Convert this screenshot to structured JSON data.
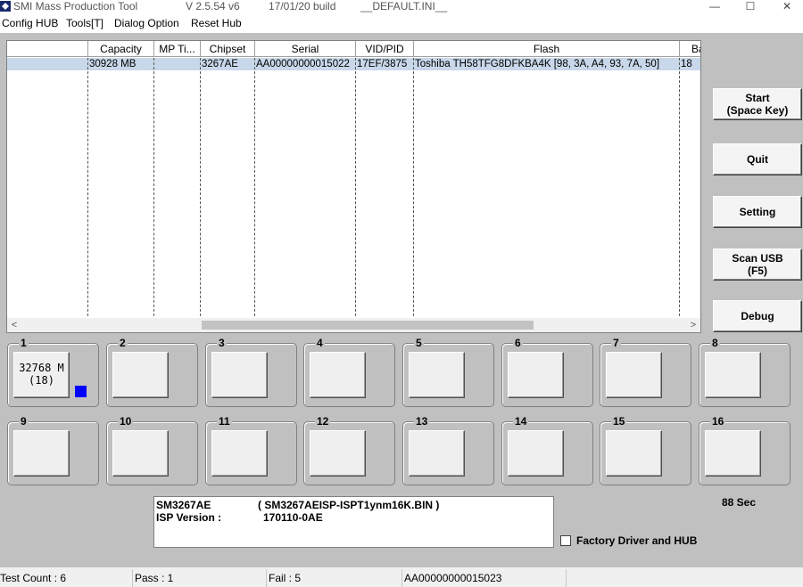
{
  "window": {
    "title": "SMI Mass Production Tool",
    "version": "V 2.5.54   v6",
    "build": "17/01/20 build",
    "ini": "__DEFAULT.INI__",
    "minimize": "—",
    "maximize": "☐",
    "close": "✕"
  },
  "menu": [
    "Config HUB",
    "Tools[T]",
    "Dialog Option",
    "Reset Hub"
  ],
  "list": {
    "columns": [
      "",
      "Capacity",
      "MP Ti...",
      "Chipset",
      "Serial",
      "VID/PID",
      "Flash",
      "Ba"
    ],
    "rows": [
      {
        "cells": [
          "",
          "30928 MB",
          "",
          "3267AE",
          "AA00000000015022",
          "17EF/3875",
          "Toshiba TH58TFG8DFKBA4K [98, 3A, A4, 93, 7A, 50]",
          "18"
        ]
      }
    ],
    "scroll_left": "<",
    "scroll_right": ">"
  },
  "actions": {
    "start": "Start\n(Space Key)",
    "quit": "Quit",
    "setting": "Setting",
    "scan_usb": "Scan USB\n(F5)",
    "debug": "Debug"
  },
  "ports": [
    {
      "num": "1",
      "label": "32768 M\n(18)",
      "status": true
    },
    {
      "num": "2",
      "label": "",
      "status": false
    },
    {
      "num": "3",
      "label": "",
      "status": false
    },
    {
      "num": "4",
      "label": "",
      "status": false
    },
    {
      "num": "5",
      "label": "",
      "status": false
    },
    {
      "num": "6",
      "label": "",
      "status": false
    },
    {
      "num": "7",
      "label": "",
      "status": false
    },
    {
      "num": "8",
      "label": "",
      "status": false
    },
    {
      "num": "9",
      "label": "",
      "status": false
    },
    {
      "num": "10",
      "label": "",
      "status": false
    },
    {
      "num": "11",
      "label": "",
      "status": false
    },
    {
      "num": "12",
      "label": "",
      "status": false
    },
    {
      "num": "13",
      "label": "",
      "status": false
    },
    {
      "num": "14",
      "label": "",
      "status": false
    },
    {
      "num": "15",
      "label": "",
      "status": false
    },
    {
      "num": "16",
      "label": "",
      "status": false
    }
  ],
  "info": {
    "chip": "SM3267AE",
    "bin": "( SM3267AEISP-ISPT1ynm16K.BIN )",
    "isp_label": "ISP Version :",
    "isp_value": "170110-0AE"
  },
  "timer": "88 Sec",
  "factory_checkbox": "Factory Driver and HUB",
  "status": {
    "test_count": "Test Count : 6",
    "pass": "Pass : 1",
    "fail": "Fail : 5",
    "serial": "AA00000000015023",
    "extra": ""
  },
  "colors": {
    "status_active": "#0000ff",
    "selected_row": "#c8d8ea",
    "client_bg": "#c0c0c0"
  }
}
